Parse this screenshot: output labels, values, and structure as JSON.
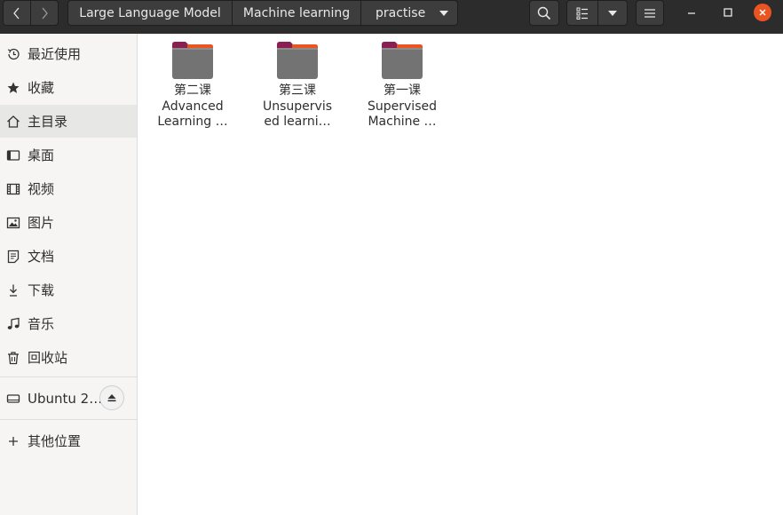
{
  "header": {
    "path": [
      "Large Language Model",
      "Machine learning",
      "practise"
    ],
    "icons": {
      "back": "chevron-left-icon",
      "forward": "chevron-right-icon",
      "path_menu": "triangle-down-icon",
      "search": "search-icon",
      "view": "list-view-icon",
      "view_options": "triangle-down-icon",
      "menu": "hamburger-menu-icon",
      "minimize": "minimize-icon",
      "maximize": "maximize-icon",
      "close": "close-icon"
    },
    "colors": {
      "bar": "#2c2c2c",
      "button": "#3d3d3d",
      "close": "#e95420"
    }
  },
  "sidebar": {
    "places": [
      {
        "label": "最近使用",
        "icon": "clock-icon"
      },
      {
        "label": "收藏",
        "icon": "star-icon"
      },
      {
        "label": "主目录",
        "icon": "home-icon",
        "active": true
      },
      {
        "label": "桌面",
        "icon": "desktop-icon"
      },
      {
        "label": "视频",
        "icon": "film-icon"
      },
      {
        "label": "图片",
        "icon": "image-icon"
      },
      {
        "label": "文档",
        "icon": "document-icon"
      },
      {
        "label": "下载",
        "icon": "download-icon"
      },
      {
        "label": "音乐",
        "icon": "music-icon"
      },
      {
        "label": "回收站",
        "icon": "trash-icon"
      }
    ],
    "devices": [
      {
        "label": "Ubuntu 2…",
        "icon": "drive-icon",
        "action_icon": "eject-icon"
      }
    ],
    "other": {
      "label": "其他位置",
      "icon": "plus-icon"
    }
  },
  "files": [
    {
      "line1": "第二课",
      "line2": "Advanced",
      "line3": "Learning …",
      "icon": "folder-icon"
    },
    {
      "line1": "第三课",
      "line2": "Unsupervis",
      "line3": "ed learni…",
      "icon": "folder-icon"
    },
    {
      "line1": "第一课",
      "line2": "Supervised",
      "line3": "Machine …",
      "icon": "folder-icon"
    }
  ]
}
